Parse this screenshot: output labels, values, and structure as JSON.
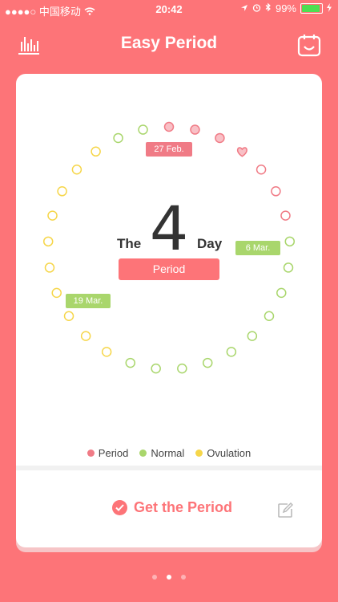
{
  "status_bar": {
    "signal": "●●●●○",
    "carrier": "中国移动",
    "time": "20:42",
    "battery": "99%",
    "battery_color": "#4ede51"
  },
  "header": {
    "title": "Easy Period",
    "left_icon": "bar-chart-icon",
    "right_icon": "calendar-face-icon"
  },
  "dial": {
    "prefix": "The",
    "day_number": "4",
    "suffix": "Day",
    "status": "Period",
    "tags": {
      "start": "27 Feb.",
      "normal": "6 Mar.",
      "ovulation": "19 Mar."
    },
    "today_marker": "heart-icon",
    "cycle_length": 29,
    "day_types": [
      "period",
      "period",
      "period",
      "period",
      "period",
      "period",
      "period",
      "normal",
      "normal",
      "normal",
      "normal",
      "normal",
      "normal",
      "normal",
      "normal",
      "normal",
      "normal",
      "ovulation",
      "ovulation",
      "ovulation",
      "ovulation",
      "ovulation",
      "ovulation",
      "ovulation",
      "ovulation",
      "ovulation",
      "ovulation",
      "normal",
      "normal"
    ],
    "filled_days": [
      1,
      2,
      3
    ]
  },
  "legend": [
    {
      "label": "Period",
      "color": "#f07b86"
    },
    {
      "label": "Normal",
      "color": "#a9d66c"
    },
    {
      "label": "Ovulation",
      "color": "#f6d64a"
    }
  ],
  "action": {
    "label": "Get the Period",
    "edit_icon": "edit-icon"
  },
  "pager": {
    "count": 3,
    "active": 1
  }
}
